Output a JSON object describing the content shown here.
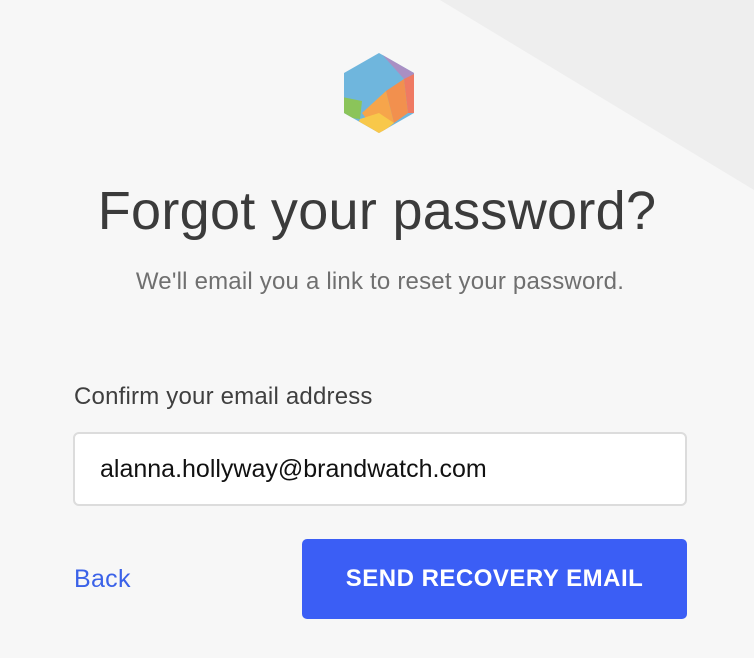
{
  "logo": {
    "icon": "hexagon-logo-icon"
  },
  "heading": {
    "title": "Forgot your password?",
    "subtitle": "We'll email you a link to reset your password."
  },
  "form": {
    "email_label": "Confirm your email address",
    "email_value": "alanna.hollyway@brandwatch.com"
  },
  "actions": {
    "back_label": "Back",
    "send_label": "SEND RECOVERY EMAIL"
  },
  "colors": {
    "background": "#f7f7f7",
    "accent": "#3b5ef5",
    "link": "#3b62e8",
    "title": "#3b3b3b"
  }
}
